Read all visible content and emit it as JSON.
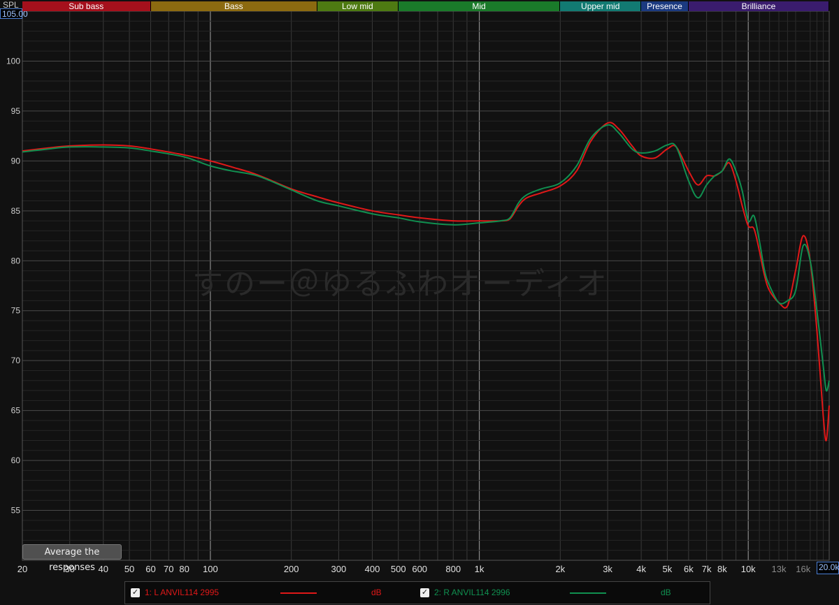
{
  "header": {
    "spl_label": "SPL",
    "ymax_value": "105.00",
    "xmax_value": "20.0k"
  },
  "bands": [
    {
      "label": "Sub bass",
      "from": 20,
      "to": 60,
      "color": "#a5101c"
    },
    {
      "label": "Bass",
      "from": 60,
      "to": 250,
      "color": "#8c6a10"
    },
    {
      "label": "Low mid",
      "from": 250,
      "to": 500,
      "color": "#4e7a12"
    },
    {
      "label": "Mid",
      "from": 500,
      "to": 2000,
      "color": "#1a7a2a"
    },
    {
      "label": "Upper mid",
      "from": 2000,
      "to": 4000,
      "color": "#127a72"
    },
    {
      "label": "Presence",
      "from": 4000,
      "to": 6000,
      "color": "#1b3a80"
    },
    {
      "label": "Brilliance",
      "from": 6000,
      "to": 20000,
      "color": "#3a1c6e"
    }
  ],
  "watermark": "すのー＠ゆるふわオーディオ",
  "average_button": "Average the responses",
  "legend": [
    {
      "check": "✓",
      "label": "1: L ANVIL114 2995",
      "unit": "dB",
      "color": "#e01818"
    },
    {
      "check": "✓",
      "label": "2: R ANVIL114 2996",
      "unit": "dB",
      "color": "#109050"
    }
  ],
  "chart_data": {
    "type": "line",
    "xscale": "log",
    "xlim": [
      20,
      20000
    ],
    "ylim": [
      50,
      105
    ],
    "ylabel": "SPL",
    "grid": true,
    "xticks": [
      {
        "v": 20,
        "label": "20"
      },
      {
        "v": 30,
        "label": "30"
      },
      {
        "v": 40,
        "label": "40"
      },
      {
        "v": 50,
        "label": "50"
      },
      {
        "v": 60,
        "label": "60"
      },
      {
        "v": 70,
        "label": "70"
      },
      {
        "v": 80,
        "label": "80"
      },
      {
        "v": 100,
        "label": "100"
      },
      {
        "v": 200,
        "label": "200"
      },
      {
        "v": 300,
        "label": "300"
      },
      {
        "v": 400,
        "label": "400"
      },
      {
        "v": 500,
        "label": "500"
      },
      {
        "v": 600,
        "label": "600"
      },
      {
        "v": 800,
        "label": "800"
      },
      {
        "v": 1000,
        "label": "1k"
      },
      {
        "v": 2000,
        "label": "2k"
      },
      {
        "v": 3000,
        "label": "3k"
      },
      {
        "v": 4000,
        "label": "4k"
      },
      {
        "v": 5000,
        "label": "5k"
      },
      {
        "v": 6000,
        "label": "6k"
      },
      {
        "v": 7000,
        "label": "7k"
      },
      {
        "v": 8000,
        "label": "8k"
      },
      {
        "v": 10000,
        "label": "10k"
      },
      {
        "v": 13000,
        "label": "13k"
      },
      {
        "v": 16000,
        "label": "16k"
      }
    ],
    "yticks": [
      55,
      60,
      65,
      70,
      75,
      80,
      85,
      90,
      95,
      100
    ],
    "series": [
      {
        "name": "1: L ANVIL114 2995",
        "color": "#e01818",
        "points": [
          [
            20,
            91.0
          ],
          [
            25,
            91.3
          ],
          [
            30,
            91.5
          ],
          [
            40,
            91.6
          ],
          [
            50,
            91.5
          ],
          [
            60,
            91.2
          ],
          [
            80,
            90.6
          ],
          [
            100,
            90.0
          ],
          [
            120,
            89.4
          ],
          [
            150,
            88.6
          ],
          [
            200,
            87.2
          ],
          [
            250,
            86.4
          ],
          [
            300,
            85.8
          ],
          [
            400,
            85.0
          ],
          [
            500,
            84.6
          ],
          [
            600,
            84.3
          ],
          [
            800,
            84.0
          ],
          [
            1000,
            84.0
          ],
          [
            1200,
            84.0
          ],
          [
            1300,
            84.2
          ],
          [
            1400,
            85.5
          ],
          [
            1500,
            86.3
          ],
          [
            1700,
            86.8
          ],
          [
            2000,
            87.5
          ],
          [
            2300,
            89.0
          ],
          [
            2600,
            92.0
          ],
          [
            3000,
            93.8
          ],
          [
            3300,
            93.2
          ],
          [
            3700,
            91.5
          ],
          [
            4000,
            90.5
          ],
          [
            4500,
            90.3
          ],
          [
            5000,
            91.2
          ],
          [
            5400,
            91.4
          ],
          [
            6000,
            89.0
          ],
          [
            6500,
            87.6
          ],
          [
            7000,
            88.5
          ],
          [
            7500,
            88.5
          ],
          [
            8000,
            89.0
          ],
          [
            8500,
            89.8
          ],
          [
            9000,
            88.0
          ],
          [
            9500,
            85.5
          ],
          [
            10000,
            83.5
          ],
          [
            10500,
            83.2
          ],
          [
            11000,
            81.0
          ],
          [
            11500,
            78.5
          ],
          [
            12000,
            77.0
          ],
          [
            13000,
            75.8
          ],
          [
            14000,
            75.5
          ],
          [
            15000,
            79.0
          ],
          [
            16000,
            82.5
          ],
          [
            17000,
            80.0
          ],
          [
            18000,
            73.0
          ],
          [
            19000,
            64.5
          ],
          [
            19500,
            62.0
          ],
          [
            20000,
            65.5
          ]
        ]
      },
      {
        "name": "2: R ANVIL114 2996",
        "color": "#109050",
        "points": [
          [
            20,
            90.9
          ],
          [
            25,
            91.2
          ],
          [
            30,
            91.4
          ],
          [
            40,
            91.4
          ],
          [
            50,
            91.3
          ],
          [
            60,
            91.0
          ],
          [
            80,
            90.4
          ],
          [
            100,
            89.5
          ],
          [
            120,
            89.0
          ],
          [
            150,
            88.5
          ],
          [
            200,
            87.1
          ],
          [
            250,
            86.0
          ],
          [
            300,
            85.5
          ],
          [
            400,
            84.7
          ],
          [
            500,
            84.3
          ],
          [
            600,
            83.9
          ],
          [
            800,
            83.6
          ],
          [
            1000,
            83.8
          ],
          [
            1200,
            84.0
          ],
          [
            1300,
            84.3
          ],
          [
            1400,
            85.8
          ],
          [
            1500,
            86.6
          ],
          [
            1700,
            87.2
          ],
          [
            2000,
            87.8
          ],
          [
            2300,
            89.5
          ],
          [
            2600,
            92.3
          ],
          [
            3000,
            93.6
          ],
          [
            3300,
            92.8
          ],
          [
            3700,
            91.2
          ],
          [
            4000,
            90.8
          ],
          [
            4500,
            91.0
          ],
          [
            5000,
            91.6
          ],
          [
            5400,
            91.4
          ],
          [
            6000,
            88.0
          ],
          [
            6500,
            86.3
          ],
          [
            7000,
            87.6
          ],
          [
            7500,
            88.5
          ],
          [
            8000,
            89.0
          ],
          [
            8500,
            90.2
          ],
          [
            9000,
            89.0
          ],
          [
            9500,
            87.0
          ],
          [
            10000,
            84.0
          ],
          [
            10500,
            84.5
          ],
          [
            11000,
            82.0
          ],
          [
            11500,
            79.0
          ],
          [
            12000,
            77.5
          ],
          [
            13000,
            75.8
          ],
          [
            14000,
            76.0
          ],
          [
            15000,
            77.0
          ],
          [
            16000,
            81.5
          ],
          [
            17000,
            80.0
          ],
          [
            18000,
            75.0
          ],
          [
            19000,
            69.5
          ],
          [
            19500,
            67.0
          ],
          [
            20000,
            68.0
          ]
        ]
      }
    ]
  }
}
